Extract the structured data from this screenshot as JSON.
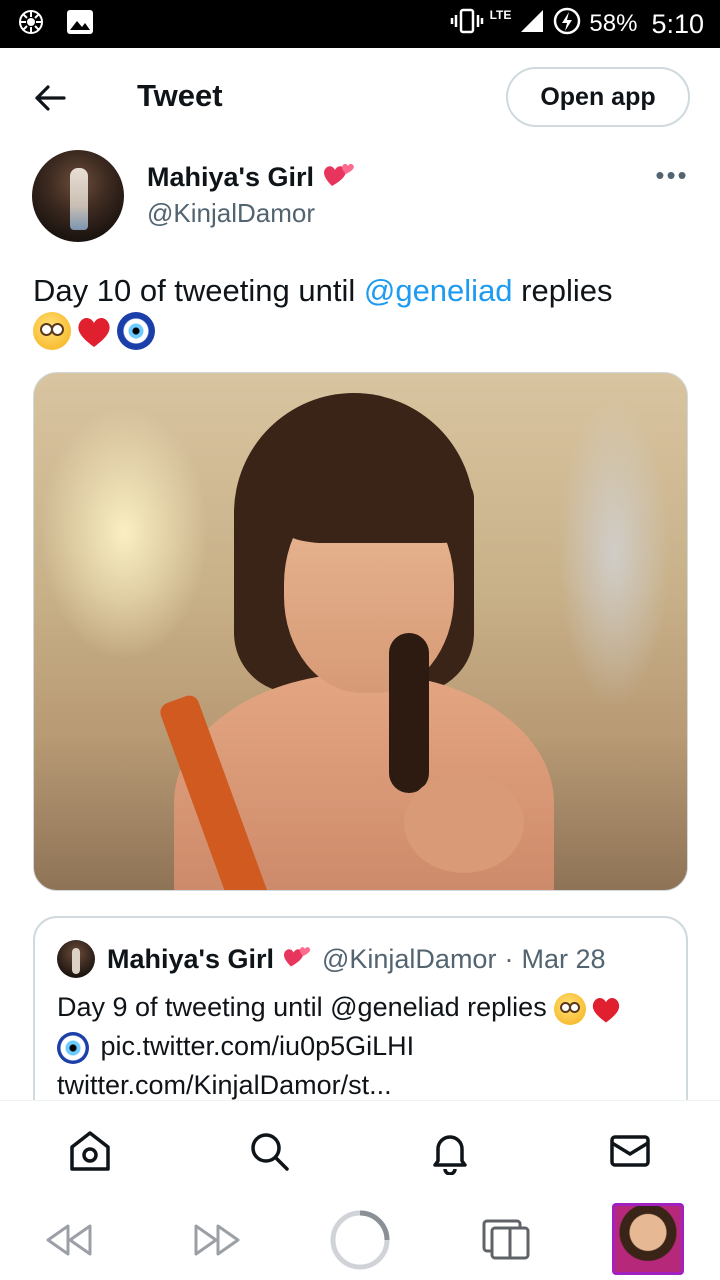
{
  "status_bar": {
    "network": "LTE",
    "battery": "58%",
    "time": "5:10"
  },
  "header": {
    "title": "Tweet",
    "open_app_label": "Open app"
  },
  "tweet": {
    "author_name": "Mahiya's Girl",
    "author_handle": "@KinjalDamor",
    "text_before": "Day 10 of tweeting until ",
    "mention": "@geneliad",
    "text_after": " replies",
    "more_label": "•••"
  },
  "quoted_tweet": {
    "author_name": "Mahiya's Girl",
    "author_handle": "@KinjalDamor",
    "separator": "·",
    "date": "Mar 28",
    "text_before": "Day 9 of tweeting until @geneliad replies",
    "link": "pic.twitter.com/iu0p5GiLHI",
    "url": "twitter.com/KinjalDamor/st..."
  },
  "icons": {
    "back": "arrow-left",
    "more": "ellipsis",
    "nav": [
      "home",
      "search",
      "notifications",
      "messages"
    ],
    "browser": [
      "back",
      "forward",
      "loading",
      "tabs",
      "thumbnail"
    ]
  },
  "colors": {
    "accent": "#1d9bf0",
    "text": "#0f1419",
    "secondary": "#536471",
    "border": "#cfd9de"
  }
}
